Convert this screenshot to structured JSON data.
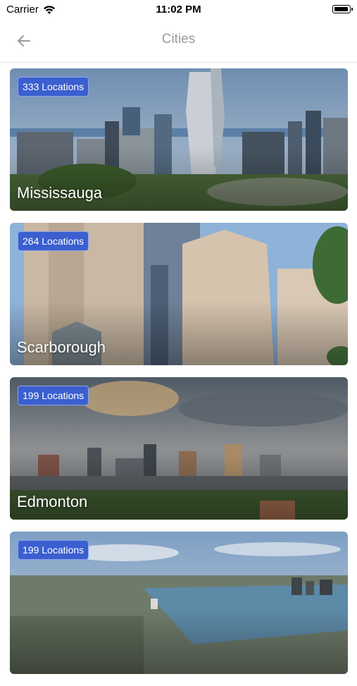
{
  "status_bar": {
    "carrier": "Carrier",
    "time": "11:02 PM"
  },
  "nav": {
    "title": "Cities",
    "back_icon": "arrow-left-icon"
  },
  "cities": [
    {
      "name": "Mississauga",
      "locations": "333 Locations"
    },
    {
      "name": "Scarborough",
      "locations": "264 Locations"
    },
    {
      "name": "Edmonton",
      "locations": "199 Locations"
    },
    {
      "name": "",
      "locations": "199 Locations"
    }
  ],
  "colors": {
    "badge_bg": "#3b5fcf",
    "badge_border": "#8ea3ee",
    "nav_title": "#9a9a9a"
  }
}
